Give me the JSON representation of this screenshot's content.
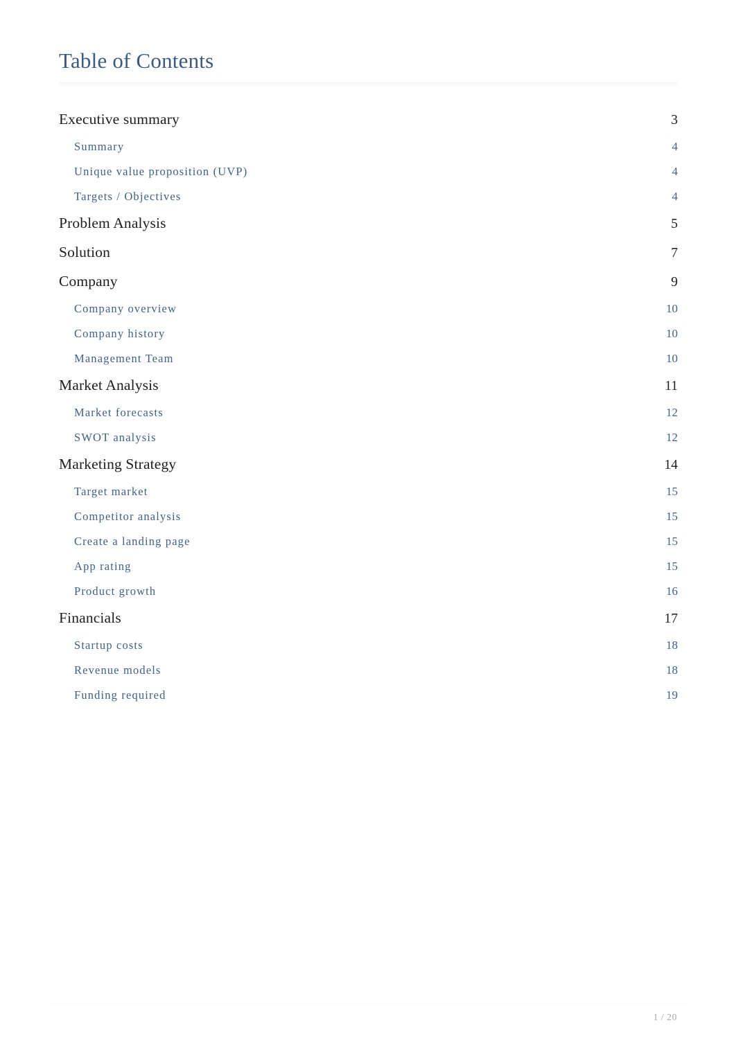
{
  "document": {
    "title": "Table of Contents",
    "footer_page_indicator": "1 / 20",
    "colors": {
      "title": "#3c5a7d",
      "level1_text": "#1d1d1d",
      "level2_text": "#3f5f87",
      "footer": "#a8a8a8",
      "page_background": "#ffffff"
    }
  },
  "toc": {
    "entries": [
      {
        "label": "Executive summary",
        "page": "3",
        "level": 1
      },
      {
        "label": "Summary",
        "page": "4",
        "level": 2
      },
      {
        "label": "Unique value proposition (UVP)",
        "page": "4",
        "level": 2
      },
      {
        "label": "Targets / Objectives",
        "page": "4",
        "level": 2
      },
      {
        "label": "Problem Analysis",
        "page": "5",
        "level": 1
      },
      {
        "label": "Solution",
        "page": "7",
        "level": 1
      },
      {
        "label": "Company",
        "page": "9",
        "level": 1
      },
      {
        "label": "Company overview",
        "page": "10",
        "level": 2
      },
      {
        "label": "Company history",
        "page": "10",
        "level": 2
      },
      {
        "label": "Management Team",
        "page": "10",
        "level": 2
      },
      {
        "label": "Market Analysis",
        "page": "11",
        "level": 1
      },
      {
        "label": "Market forecasts",
        "page": "12",
        "level": 2
      },
      {
        "label": "SWOT analysis",
        "page": "12",
        "level": 2
      },
      {
        "label": "Marketing Strategy",
        "page": "14",
        "level": 1
      },
      {
        "label": "Target market",
        "page": "15",
        "level": 2
      },
      {
        "label": "Competitor analysis",
        "page": "15",
        "level": 2
      },
      {
        "label": "Create a landing page",
        "page": "15",
        "level": 2
      },
      {
        "label": "App rating",
        "page": "15",
        "level": 2
      },
      {
        "label": "Product growth",
        "page": "16",
        "level": 2
      },
      {
        "label": "Financials",
        "page": "17",
        "level": 1
      },
      {
        "label": "Startup costs",
        "page": "18",
        "level": 2
      },
      {
        "label": "Revenue models",
        "page": "18",
        "level": 2
      },
      {
        "label": "Funding required",
        "page": "19",
        "level": 2
      }
    ]
  }
}
